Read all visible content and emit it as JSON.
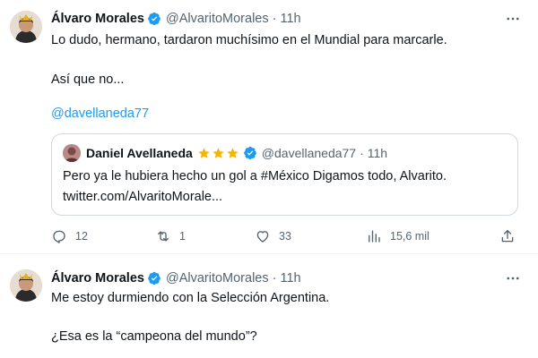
{
  "tweet1": {
    "author": "Álvaro Morales",
    "handle": "@AlvaritoMorales",
    "separator": "·",
    "time": "11h",
    "text_line1": "Lo dudo, hermano, tardaron muchísimo en el Mundial para marcarle.",
    "text_line2": "Así que no...",
    "mention": "@davellaneda77",
    "quote": {
      "author": "Daniel Avellaneda",
      "handle": "@davellaneda77",
      "separator": "·",
      "time": "11h",
      "text_line1": "Pero ya le hubiera hecho un gol a #México Digamos todo, Alvarito.",
      "text_line2": "twitter.com/AlvaritoMorale..."
    },
    "actions": {
      "replies": "12",
      "retweets": "1",
      "likes": "33",
      "views": "15,6 mil"
    }
  },
  "tweet2": {
    "author": "Álvaro Morales",
    "handle": "@AlvaritoMorales",
    "separator": "·",
    "time": "11h",
    "text_line1": "Me estoy durmiendo con la Selección Argentina.",
    "text_line2": "¿Esa es la “campeona del mundo”?"
  },
  "colors": {
    "text": "#0f1419",
    "secondary": "#536471",
    "accent": "#1d9bf0",
    "border": "#cfd9de",
    "star": "#f4b400"
  },
  "icons": {
    "verified": "verified-badge-icon",
    "more": "more-dots-icon",
    "reply": "reply-icon",
    "retweet": "retweet-icon",
    "like": "heart-icon",
    "views": "views-bar-icon",
    "share": "share-icon",
    "star": "star-icon"
  }
}
